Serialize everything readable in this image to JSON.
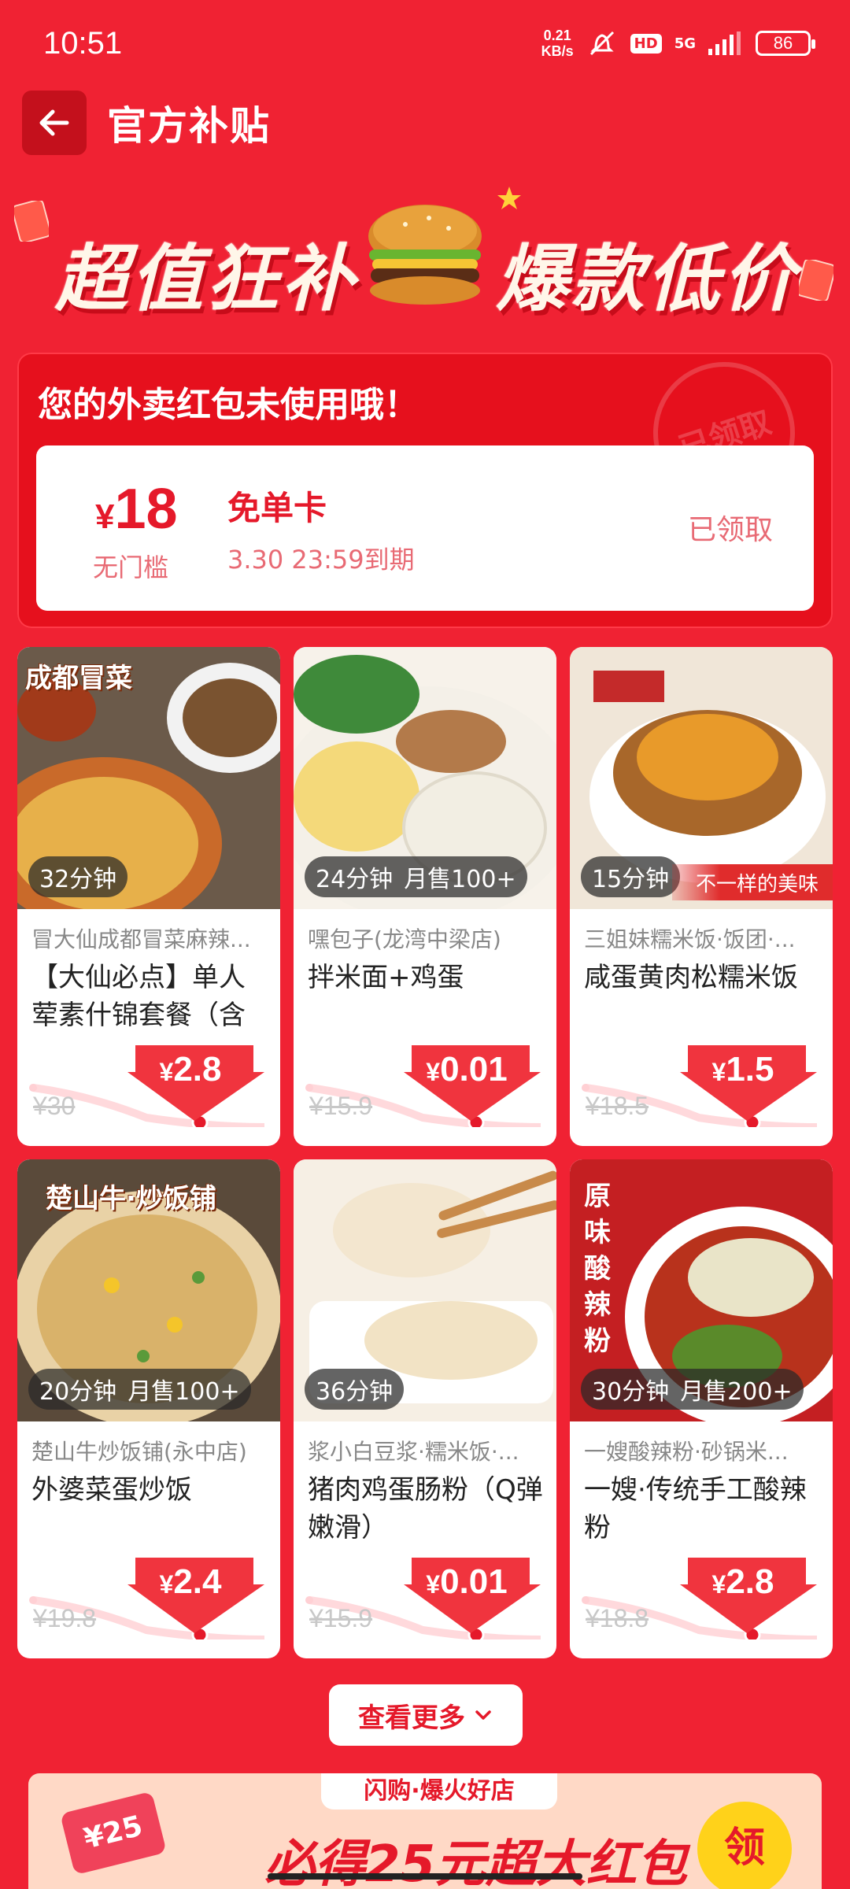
{
  "status_bar": {
    "time": "10:51",
    "net_speed_value": "0.21",
    "net_speed_unit": "KB/s",
    "hd": "HD",
    "network": "5G",
    "battery": "86"
  },
  "header": {
    "title": "官方补贴"
  },
  "banner": {
    "left_text": "超值狂补",
    "right_text": "爆款低价"
  },
  "coupon": {
    "heading": "您的外卖红包未使用哦！",
    "stamp": "已领取",
    "currency": "¥",
    "amount": "18",
    "threshold": "无门槛",
    "name": "免单卡",
    "expiry": "3.30 23:59到期",
    "status": "已领取"
  },
  "products": [
    {
      "caption": "成都冒菜",
      "eta": "32分钟",
      "sales": "",
      "promo": "",
      "shop": "冒大仙成都冒菜麻辣...",
      "dish": "【大仙必点】单人荤素什锦套餐（含",
      "currency": "¥",
      "price": "2.8",
      "old_price": "¥30"
    },
    {
      "caption": "",
      "eta": "24分钟",
      "sales": "月售100+",
      "promo": "",
      "shop": "嘿包子(龙湾中梁店)",
      "dish": "拌米面+鸡蛋",
      "currency": "¥",
      "price": "0.01",
      "old_price": "¥15.9"
    },
    {
      "caption": "",
      "eta": "15分钟",
      "sales": "",
      "promo": "不一样的美味",
      "shop": "三姐妹糯米饭·饭团·...",
      "dish": "咸蛋黄肉松糯米饭",
      "currency": "¥",
      "price": "1.5",
      "old_price": "¥18.5"
    },
    {
      "caption": "楚山牛·炒饭铺",
      "eta": "20分钟",
      "sales": "月售100+",
      "promo": "",
      "shop": "楚山牛炒饭铺(永中店)",
      "dish": "外婆菜蛋炒饭",
      "currency": "¥",
      "price": "2.4",
      "old_price": "¥19.8"
    },
    {
      "caption": "",
      "eta": "36分钟",
      "sales": "",
      "promo": "",
      "shop": "浆小白豆浆·糯米饭·...",
      "dish": "猪肉鸡蛋肠粉（Q弹嫩滑）",
      "currency": "¥",
      "price": "0.01",
      "old_price": "¥15.9"
    },
    {
      "caption": "原味酸辣粉",
      "eta": "30分钟",
      "sales": "月售200+",
      "promo": "",
      "shop": "一嫂酸辣粉·砂锅米...",
      "dish": "一嫂·传统手工酸辣粉",
      "currency": "¥",
      "price": "2.8",
      "old_price": "¥18.8"
    }
  ],
  "see_more": "查看更多",
  "bottom_banner": {
    "tag": "闪购·爆火好店",
    "headline": "必得25元超大红包",
    "coupon": "¥25",
    "claim": "领"
  },
  "colors": {
    "background": "#f02233",
    "accent": "#e5192a",
    "card": "#ffffff"
  }
}
